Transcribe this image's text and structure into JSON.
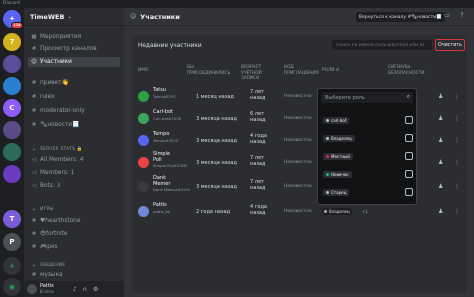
{
  "window": {
    "app_name": "Discord"
  },
  "servers": [
    {
      "icon": "home-icon",
      "color": "#5865f2",
      "badge": "114"
    },
    {
      "label": "7",
      "color": "#d6b21d"
    },
    {
      "icon": "sticker-server",
      "color": "#5a4d9c"
    },
    {
      "icon": "server-icon-2",
      "color": "#2b7fd0"
    },
    {
      "label": "C",
      "color": "#8b5cf6"
    },
    {
      "icon": "server-icon-3",
      "color": "#5c4b8a"
    },
    {
      "icon": "server-icon-4",
      "color": "#2a6b5a"
    },
    {
      "icon": "server-icon-5",
      "color": "#6c3bbd"
    },
    {
      "label": "T",
      "color": "#7c5cd6"
    },
    {
      "label": "P",
      "color": "#4e5058"
    },
    {
      "icon": "add-server-icon",
      "color": "#313338"
    },
    {
      "icon": "explore-icon",
      "color": "#313338"
    }
  ],
  "guild": {
    "name": "TimeWEB"
  },
  "channels": [
    {
      "icon": "calendar-icon",
      "label": "Мероприятия"
    },
    {
      "icon": "browse-icon",
      "label": "Просмотр каналов"
    },
    {
      "icon": "members-icon",
      "label": "Участники",
      "active": true
    },
    {
      "icon": "hash-icon",
      "label": "привет👋"
    },
    {
      "icon": "hash-icon",
      "label": "rulex"
    },
    {
      "icon": "hash-icon",
      "label": "moderator-only"
    },
    {
      "icon": "hash-icon",
      "label": "🗞новости📃"
    },
    {
      "category": true,
      "label": "SERVER STATS 🔒"
    },
    {
      "icon": "speaker-icon",
      "label": "All Members: 4"
    },
    {
      "icon": "speaker-icon",
      "label": "Members: 1"
    },
    {
      "icon": "speaker-icon",
      "label": "Bots: 3"
    },
    {
      "category": true,
      "label": "ИГРЫ"
    },
    {
      "icon": "hash-icon",
      "label": "♥hearthstone"
    },
    {
      "icon": "hash-icon",
      "label": "😎fortnite"
    },
    {
      "icon": "hash-icon",
      "label": "🎮pes"
    },
    {
      "category": true,
      "label": "ОБЩЕНИЕ"
    },
    {
      "icon": "hash-icon",
      "label": "музыка"
    }
  ],
  "user": {
    "name": "Pattis",
    "status": "В сети"
  },
  "header": {
    "title": "Участники",
    "back_label": "Вернуться к каналу",
    "channel_chip": "#🗞новости📃"
  },
  "panel": {
    "title": "Недавние участники",
    "search_placeholder": "Поиск по имени пользователя или ID",
    "clear_label": "Очистить",
    "columns": {
      "name": "ИМЯ",
      "joined": "ВЫ ПРИСОЕДИНИЛИСЬ",
      "account_age": "ВОЗРАСТ УЧЁТНОЙ ЗАПИСИ",
      "invite_code": "КОД ПРИГЛАШЕНИЯ",
      "roles": "РОЛИ",
      "signals": "СИГНАЛЫ БЕЗОПАСНОСТИ"
    }
  },
  "members": [
    {
      "name": "Tatsu",
      "tag": "Tatsu#8792",
      "joined": "1 месяц назад",
      "account_age": [
        "7 лет",
        "назад"
      ],
      "invite": "Неизвестно",
      "avatar_color": "#2ea043"
    },
    {
      "name": "Carl-bot",
      "tag": "Carl-bot#1536",
      "joined": "3 месяца назад",
      "account_age": [
        "6 лет",
        "назад"
      ],
      "invite": "Неизвестно",
      "avatar_color": "#3ba55c"
    },
    {
      "name": "Tempo",
      "tag": "Tempo#3520",
      "joined": "3 месяца назад",
      "account_age": [
        "4 года",
        "назад"
      ],
      "invite": "Неизвестно",
      "avatar_color": "#5865f2"
    },
    {
      "name": "Simple",
      "name2": "Poll",
      "tag": "Simple Poll#2328",
      "joined": "3 месяца назад",
      "account_age": [
        "7 лет",
        "назад"
      ],
      "invite": "Неизвестно",
      "avatar_color": "#ed4245"
    },
    {
      "name": "Dank",
      "name2": "Memer",
      "tag": "Dank Memer#5192",
      "joined": "3 месяца назад",
      "account_age": [
        "7 лет",
        "назад"
      ],
      "invite": "Неизвестно",
      "avatar_color": "#3a3a3a"
    },
    {
      "name": "Pattis",
      "tag": "pattis_bk",
      "joined": "2 года назад",
      "account_age": [
        "4 года",
        "назад"
      ],
      "invite": "Неизвестно",
      "avatar_color": "#7289da",
      "role": "Владелец",
      "more": "+1"
    }
  ],
  "role_dropdown": {
    "placeholder": "Выберите роль",
    "roles": [
      {
        "label": "carl-bot",
        "color": "#b5bac1"
      },
      {
        "label": "Владелец",
        "color": "#b5bac1"
      },
      {
        "label": "Местный",
        "color": "#e91e63"
      },
      {
        "label": "Новичок",
        "color": "#1abc9c"
      },
      {
        "label": "Старец",
        "color": "#b5bac1"
      }
    ]
  }
}
